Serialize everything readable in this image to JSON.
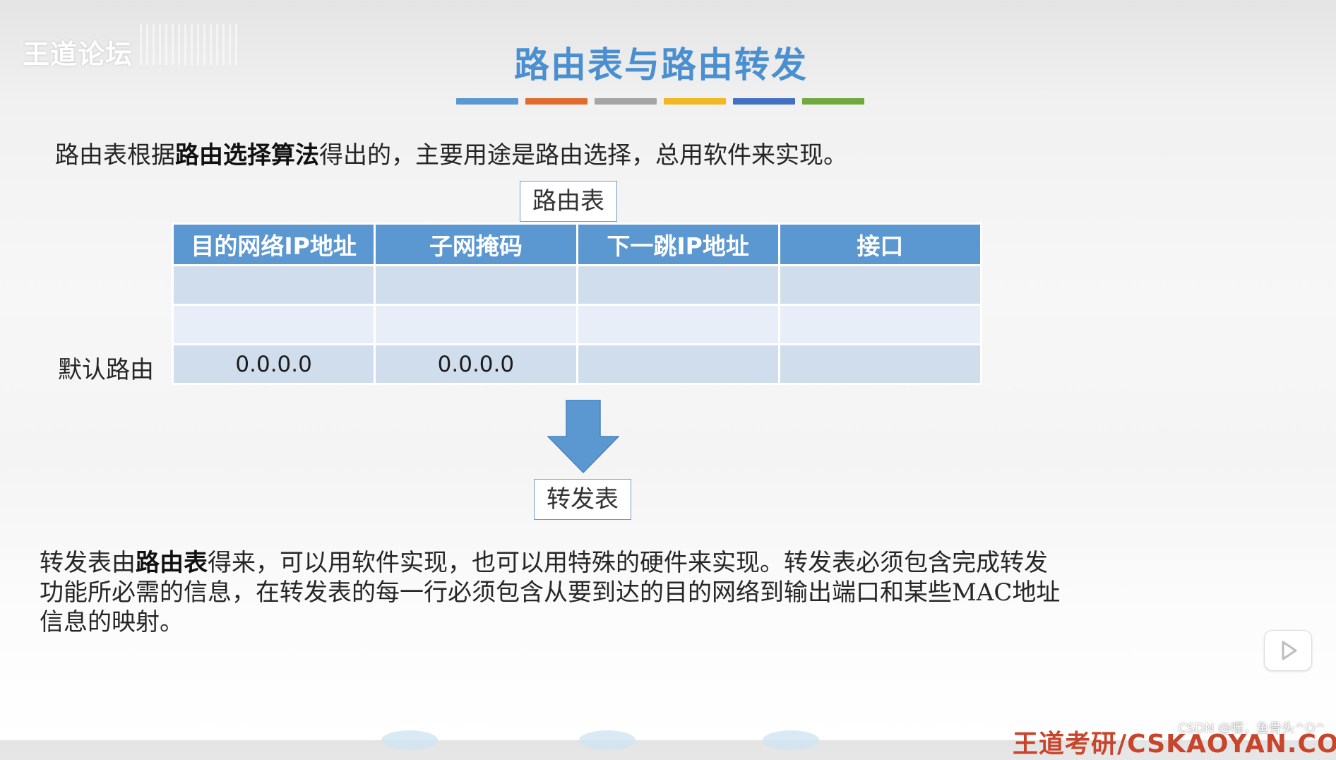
{
  "watermark": {
    "logo_text": "王道论坛"
  },
  "slide": {
    "title": "路由表与路由转发",
    "title_color": "#4a8fd0",
    "color_bar": [
      "#5b97d1",
      "#e06b2f",
      "#a5a5a5",
      "#f2b722",
      "#4470c4",
      "#6fa93f"
    ]
  },
  "intro": {
    "part1": "路由表根据",
    "bold": "路由选择算法",
    "part2": "得出的，主要用途是路由选择，总用软件来实现。"
  },
  "routing_table": {
    "label": "路由表",
    "headers": [
      "目的网络IP地址",
      "子网掩码",
      "下一跳IP地址",
      "接口"
    ],
    "rows": [
      [
        "",
        "",
        "",
        ""
      ],
      [
        "",
        "",
        "",
        ""
      ],
      [
        "0.0.0.0",
        "0.0.0.0",
        "",
        ""
      ]
    ],
    "default_route_label": "默认路由",
    "header_color": "#5b97d1"
  },
  "arrow": {
    "icon": "arrow-down-icon",
    "color": "#5b97d1"
  },
  "forwarding_table": {
    "label": "转发表"
  },
  "paragraph": {
    "l1a": "转发表由",
    "l1b": "路由表",
    "l1c": "得来，可以用软件实现，也可以用特殊的硬件来实现。转发表必须包含完成转发",
    "l2": "功能所必需的信息，在转发表的每一行必须包含从要到达的目的网络到输出端口和某些MAC地址",
    "l3": "信息的映射。"
  },
  "player": {
    "icon": "play-icon"
  },
  "footer": {
    "brand": "王道考研/CSKAOYAN.COM",
    "csdn": "CSDN @嘿，鱼骨头^O^"
  }
}
